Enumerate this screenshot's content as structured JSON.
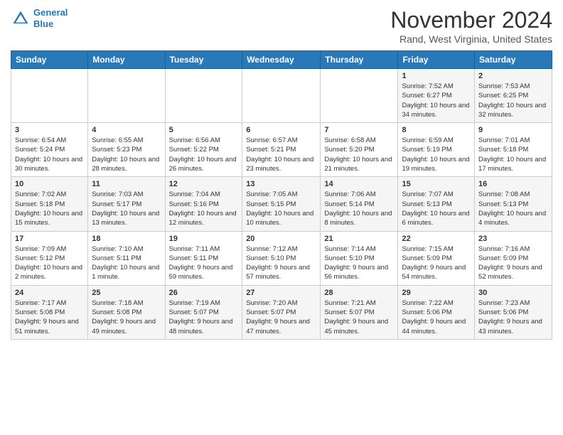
{
  "header": {
    "logo_line1": "General",
    "logo_line2": "Blue",
    "month": "November 2024",
    "location": "Rand, West Virginia, United States"
  },
  "weekdays": [
    "Sunday",
    "Monday",
    "Tuesday",
    "Wednesday",
    "Thursday",
    "Friday",
    "Saturday"
  ],
  "weeks": [
    [
      {
        "day": "",
        "info": ""
      },
      {
        "day": "",
        "info": ""
      },
      {
        "day": "",
        "info": ""
      },
      {
        "day": "",
        "info": ""
      },
      {
        "day": "",
        "info": ""
      },
      {
        "day": "1",
        "info": "Sunrise: 7:52 AM\nSunset: 6:27 PM\nDaylight: 10 hours and 34 minutes."
      },
      {
        "day": "2",
        "info": "Sunrise: 7:53 AM\nSunset: 6:25 PM\nDaylight: 10 hours and 32 minutes."
      }
    ],
    [
      {
        "day": "3",
        "info": "Sunrise: 6:54 AM\nSunset: 5:24 PM\nDaylight: 10 hours and 30 minutes."
      },
      {
        "day": "4",
        "info": "Sunrise: 6:55 AM\nSunset: 5:23 PM\nDaylight: 10 hours and 28 minutes."
      },
      {
        "day": "5",
        "info": "Sunrise: 6:56 AM\nSunset: 5:22 PM\nDaylight: 10 hours and 26 minutes."
      },
      {
        "day": "6",
        "info": "Sunrise: 6:57 AM\nSunset: 5:21 PM\nDaylight: 10 hours and 23 minutes."
      },
      {
        "day": "7",
        "info": "Sunrise: 6:58 AM\nSunset: 5:20 PM\nDaylight: 10 hours and 21 minutes."
      },
      {
        "day": "8",
        "info": "Sunrise: 6:59 AM\nSunset: 5:19 PM\nDaylight: 10 hours and 19 minutes."
      },
      {
        "day": "9",
        "info": "Sunrise: 7:01 AM\nSunset: 5:18 PM\nDaylight: 10 hours and 17 minutes."
      }
    ],
    [
      {
        "day": "10",
        "info": "Sunrise: 7:02 AM\nSunset: 5:18 PM\nDaylight: 10 hours and 15 minutes."
      },
      {
        "day": "11",
        "info": "Sunrise: 7:03 AM\nSunset: 5:17 PM\nDaylight: 10 hours and 13 minutes."
      },
      {
        "day": "12",
        "info": "Sunrise: 7:04 AM\nSunset: 5:16 PM\nDaylight: 10 hours and 12 minutes."
      },
      {
        "day": "13",
        "info": "Sunrise: 7:05 AM\nSunset: 5:15 PM\nDaylight: 10 hours and 10 minutes."
      },
      {
        "day": "14",
        "info": "Sunrise: 7:06 AM\nSunset: 5:14 PM\nDaylight: 10 hours and 8 minutes."
      },
      {
        "day": "15",
        "info": "Sunrise: 7:07 AM\nSunset: 5:13 PM\nDaylight: 10 hours and 6 minutes."
      },
      {
        "day": "16",
        "info": "Sunrise: 7:08 AM\nSunset: 5:13 PM\nDaylight: 10 hours and 4 minutes."
      }
    ],
    [
      {
        "day": "17",
        "info": "Sunrise: 7:09 AM\nSunset: 5:12 PM\nDaylight: 10 hours and 2 minutes."
      },
      {
        "day": "18",
        "info": "Sunrise: 7:10 AM\nSunset: 5:11 PM\nDaylight: 10 hours and 1 minute."
      },
      {
        "day": "19",
        "info": "Sunrise: 7:11 AM\nSunset: 5:11 PM\nDaylight: 9 hours and 59 minutes."
      },
      {
        "day": "20",
        "info": "Sunrise: 7:12 AM\nSunset: 5:10 PM\nDaylight: 9 hours and 57 minutes."
      },
      {
        "day": "21",
        "info": "Sunrise: 7:14 AM\nSunset: 5:10 PM\nDaylight: 9 hours and 56 minutes."
      },
      {
        "day": "22",
        "info": "Sunrise: 7:15 AM\nSunset: 5:09 PM\nDaylight: 9 hours and 54 minutes."
      },
      {
        "day": "23",
        "info": "Sunrise: 7:16 AM\nSunset: 5:09 PM\nDaylight: 9 hours and 52 minutes."
      }
    ],
    [
      {
        "day": "24",
        "info": "Sunrise: 7:17 AM\nSunset: 5:08 PM\nDaylight: 9 hours and 51 minutes."
      },
      {
        "day": "25",
        "info": "Sunrise: 7:18 AM\nSunset: 5:08 PM\nDaylight: 9 hours and 49 minutes."
      },
      {
        "day": "26",
        "info": "Sunrise: 7:19 AM\nSunset: 5:07 PM\nDaylight: 9 hours and 48 minutes."
      },
      {
        "day": "27",
        "info": "Sunrise: 7:20 AM\nSunset: 5:07 PM\nDaylight: 9 hours and 47 minutes."
      },
      {
        "day": "28",
        "info": "Sunrise: 7:21 AM\nSunset: 5:07 PM\nDaylight: 9 hours and 45 minutes."
      },
      {
        "day": "29",
        "info": "Sunrise: 7:22 AM\nSunset: 5:06 PM\nDaylight: 9 hours and 44 minutes."
      },
      {
        "day": "30",
        "info": "Sunrise: 7:23 AM\nSunset: 5:06 PM\nDaylight: 9 hours and 43 minutes."
      }
    ]
  ]
}
